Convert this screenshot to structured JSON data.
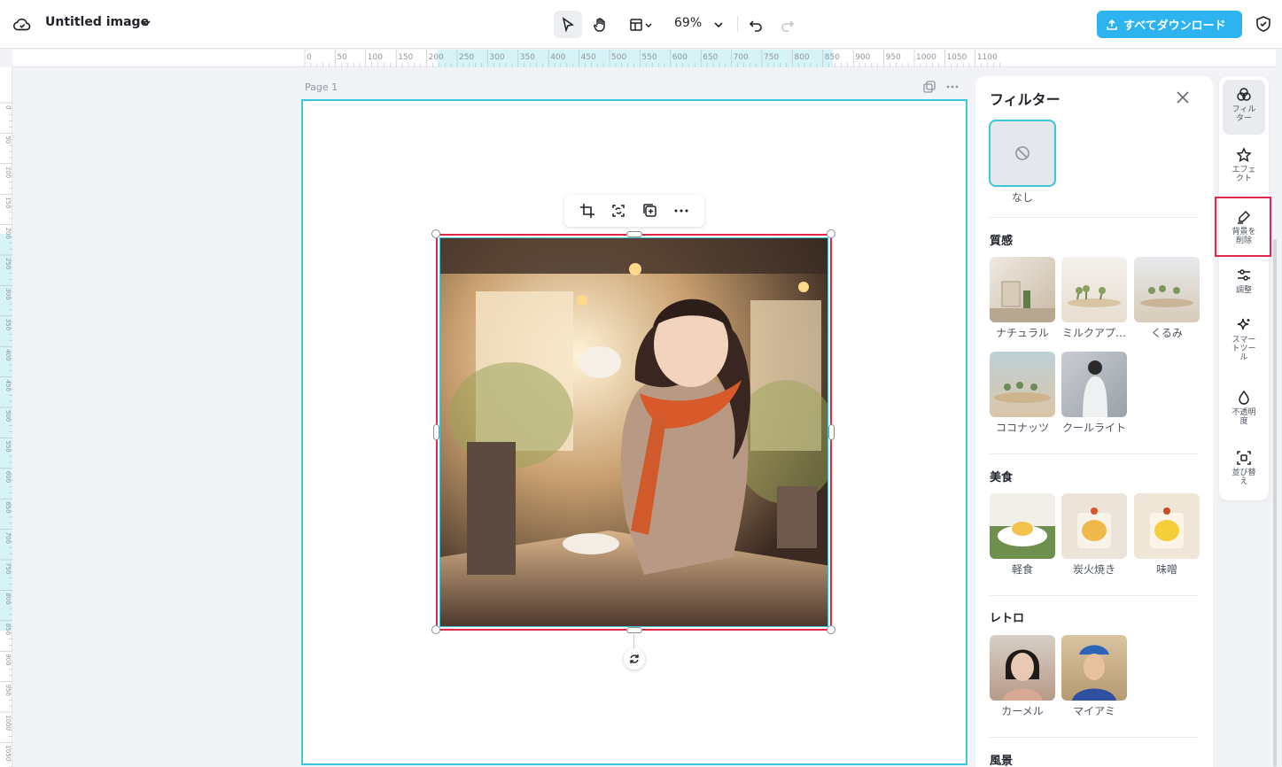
{
  "header": {
    "title": "Untitled image",
    "zoom": "69%",
    "download_label": "すべてダウンロード"
  },
  "ruler": {
    "h_ticks": [
      "0",
      "50",
      "100",
      "150",
      "200",
      "250",
      "300",
      "350",
      "400",
      "450",
      "500",
      "550",
      "600",
      "650",
      "700",
      "750",
      "800",
      "850",
      "900",
      "950",
      "1000",
      "1050",
      "1100"
    ],
    "v_ticks": [
      "0",
      "50",
      "100",
      "150",
      "200",
      "250",
      "300",
      "350",
      "400",
      "450",
      "500",
      "550",
      "600",
      "650",
      "700",
      "750",
      "800",
      "850",
      "900",
      "950",
      "1000",
      "1050"
    ]
  },
  "canvas": {
    "page_label": "Page 1"
  },
  "panel": {
    "title": "フィルター",
    "none_label": "なし",
    "sections": [
      {
        "title": "質感",
        "items": [
          "ナチュラル",
          "ミルクアプ…",
          "くるみ",
          "ココナッツ",
          "クールライト"
        ]
      },
      {
        "title": "美食",
        "items": [
          "軽食",
          "炭火焼き",
          "味噌"
        ]
      },
      {
        "title": "レトロ",
        "items": [
          "カーメル",
          "マイアミ"
        ]
      },
      {
        "title": "風景",
        "items": []
      }
    ]
  },
  "rail": {
    "items": [
      "フィルター",
      "エフェクト",
      "背景を削除",
      "調整",
      "スマートツール",
      "不透明度",
      "並び替え"
    ]
  },
  "colors": {
    "accent": "#2cb3f0",
    "selection": "#3cc6d8",
    "highlight": "#e0284f"
  }
}
